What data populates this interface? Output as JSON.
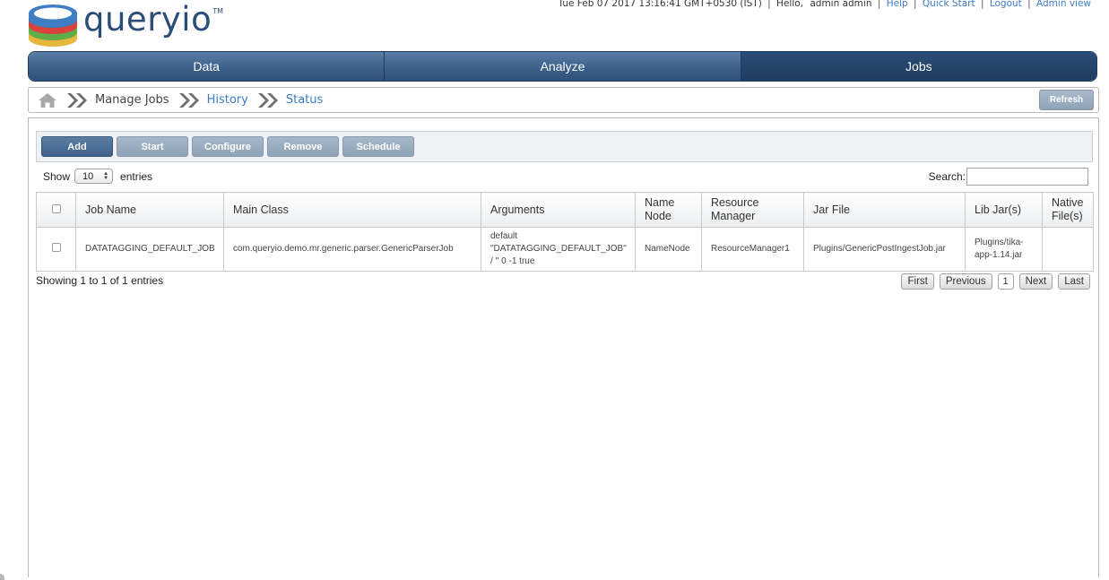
{
  "brand": {
    "name": "queryio",
    "tm": "TM"
  },
  "topbar": {
    "datetime": "Tue Feb 07 2017 13:16:41 GMT+0530 (IST)",
    "greeting": "Hello,",
    "user": "admin admin",
    "links": {
      "help": "Help",
      "quick_start": "Quick Start",
      "logout": "Logout",
      "admin_view": "Admin view"
    }
  },
  "nav": {
    "tabs": [
      {
        "label": "Data"
      },
      {
        "label": "Analyze"
      },
      {
        "label": "Jobs",
        "active": true
      }
    ]
  },
  "breadcrumb": {
    "items": [
      {
        "label": "Manage Jobs"
      },
      {
        "label": "History"
      },
      {
        "label": "Status"
      }
    ],
    "refresh_label": "Refresh"
  },
  "toolbar": {
    "add": "Add",
    "start": "Start",
    "configure": "Configure",
    "remove": "Remove",
    "schedule": "Schedule"
  },
  "length": {
    "show_label": "Show",
    "value": "10",
    "entries_label": "entries"
  },
  "search": {
    "label": "Search:",
    "value": ""
  },
  "table": {
    "headers": {
      "job_name": "Job Name",
      "main_class": "Main Class",
      "arguments": "Arguments",
      "name_node": "Name Node",
      "resource_manager": "Resource Manager",
      "jar_file": "Jar File",
      "lib_jars": "Lib Jar(s)",
      "native_files": "Native File(s)"
    },
    "rows": [
      {
        "job_name": "DATATAGGING_DEFAULT_JOB",
        "main_class": "com.queryio.demo.mr.generic.parser.GenericParserJob",
        "arguments": "default \"DATATAGGING_DEFAULT_JOB\" / '' 0 -1 true",
        "name_node": "NameNode",
        "resource_manager": "ResourceManager1",
        "jar_file": "Plugins/GenericPostIngestJob.jar",
        "lib_jars": "Plugins/tika-app-1.14.jar",
        "native_files": ""
      }
    ]
  },
  "info": "Showing 1 to 1 of 1 entries",
  "pager": {
    "first": "First",
    "previous": "Previous",
    "page": "1",
    "next": "Next",
    "last": "Last"
  },
  "colors": {
    "nav_active": "#1f3d63",
    "link": "#3b7bc5",
    "button_primary": "#3d6189"
  }
}
